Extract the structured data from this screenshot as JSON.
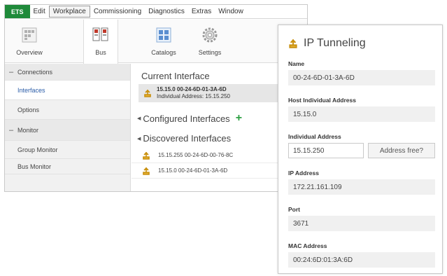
{
  "menubar": {
    "items": [
      "ETS",
      "Edit",
      "Workplace",
      "Commissioning",
      "Diagnostics",
      "Extras",
      "Window"
    ]
  },
  "toolbar": {
    "overview_label": "Overview",
    "bus_label": "Bus",
    "catalogs_label": "Catalogs",
    "settings_label": "Settings"
  },
  "sidebar": {
    "connections_label": "Connections",
    "interfaces_label": "Interfaces",
    "options_label": "Options",
    "monitor_label": "Monitor",
    "group_monitor_label": "Group Monitor",
    "bus_monitor_label": "Bus Monitor"
  },
  "main": {
    "current_heading": "Current Interface",
    "current_line1": "15.15.0 00-24-6D-01-3A-6D",
    "current_line2": "Individual Address: 15.15.250",
    "configured_heading": "Configured Interfaces",
    "discovered_heading": "Discovered Interfaces",
    "discovered": [
      "15.15.255 00-24-6D-00-76-8C",
      "15.15.0 00-24-6D-01-3A-6D"
    ]
  },
  "panel": {
    "title": "IP Tunneling",
    "name_label": "Name",
    "name_value": "00-24-6D-01-3A-6D",
    "host_label": "Host Individual Address",
    "host_value": "15.15.0",
    "indiv_label": "Individual Address",
    "indiv_value": "15.15.250",
    "address_free_label": "Address free?",
    "ip_label": "IP Address",
    "ip_value": "172.21.161.109",
    "port_label": "Port",
    "port_value": "3671",
    "mac_label": "MAC Address",
    "mac_value": "00:24:6D:01:3A:6D"
  },
  "colors": {
    "brand_green": "#1f8a3a",
    "plus_green": "#2ea043",
    "selected_blue": "#2a5ca8",
    "interface_icon": "#c89010"
  },
  "icons": {
    "overview": "overview-icon",
    "bus": "bus-icon",
    "catalogs": "catalogs-icon",
    "settings": "gear-icon",
    "interface": "ip-interface-icon",
    "add": "plus-icon"
  }
}
